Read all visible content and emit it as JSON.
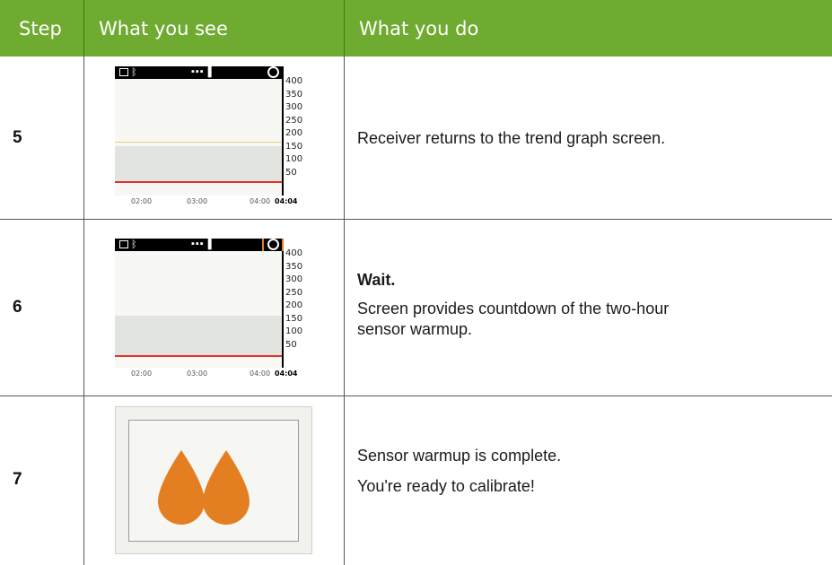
{
  "header": {
    "col_step": "Step",
    "col_see": "What you see",
    "col_do": "What you do",
    "color": "#6eab30"
  },
  "rows": [
    {
      "step": "5",
      "screen": {
        "y_labels": [
          "400",
          "350",
          "300",
          "250",
          "200",
          "150",
          "100",
          "50"
        ],
        "x_labels": [
          "02:00",
          "03:00",
          "04:00",
          "04:04"
        ]
      },
      "paragraphs": [
        "Receiver returns to the trend graph screen."
      ]
    },
    {
      "step": "6",
      "screen": {
        "y_labels": [
          "400",
          "350",
          "300",
          "250",
          "200",
          "150",
          "100",
          "50"
        ],
        "x_labels": [
          "02:00",
          "03:00",
          "04:00",
          "04:04"
        ],
        "highlight": "warmup countdown icon"
      },
      "title": "Wait.",
      "paragraphs": [
        "Screen provides countdown of the two-hour sensor warmup."
      ]
    },
    {
      "step": "7",
      "screen": {
        "icon": "two blood drops"
      },
      "paragraphs": [
        "Sensor warmup is complete.",
        "You're ready to calibrate!"
      ]
    }
  ],
  "accent_orange": "#e47f21"
}
